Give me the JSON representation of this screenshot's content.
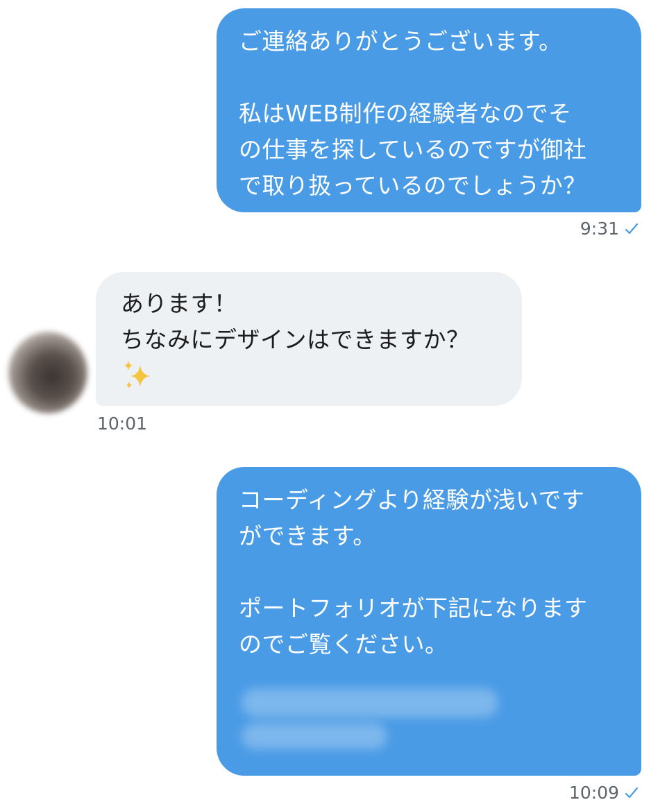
{
  "messages": [
    {
      "direction": "outgoing",
      "lines": [
        "ご連絡ありがとうございます。",
        "",
        "私はWEB制作の経験者なのでそ",
        "の仕事を探しているのですが御社",
        "で取り扱っているのでしょうか？"
      ],
      "time": "9:31"
    },
    {
      "direction": "incoming",
      "lines": [
        "あります！",
        "ちなみにデザインはできますか？"
      ],
      "emoji": "sparkles",
      "time": "10:01"
    },
    {
      "direction": "outgoing",
      "lines": [
        "コーディングより経験が浅いです",
        "ができます。",
        "",
        "ポートフォリオが下記になります",
        "のでご覧ください。"
      ],
      "time": "10:09"
    }
  ],
  "colors": {
    "outgoing_bubble": "#4a9be6",
    "incoming_bubble": "#eef1f4",
    "read_check": "#4a9be6",
    "timestamp": "#5d646b"
  },
  "icons": {
    "read_receipt": "checkmark-icon",
    "emoji": "sparkles-icon"
  }
}
